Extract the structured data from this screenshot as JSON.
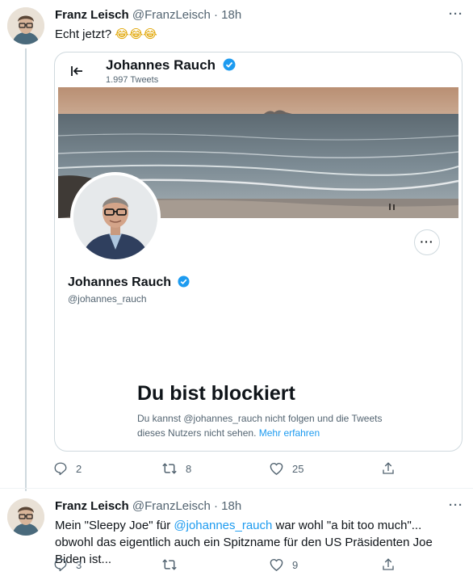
{
  "tweet1": {
    "author_name": "Franz Leisch",
    "author_handle": "@FranzLeisch",
    "separator": "·",
    "time": "18h",
    "text": "Echt jetzt?",
    "emojis": "😂😂😂",
    "more": "···",
    "card": {
      "header_name": "Johannes Rauch",
      "tweet_count": "1.997 Tweets",
      "profile_name": "Johannes Rauch",
      "profile_handle": "@johannes_rauch",
      "more": "···",
      "blocked_title": "Du bist blockiert",
      "blocked_text": "Du kannst @johannes_rauch nicht folgen und die Tweets dieses Nutzers nicht sehen.",
      "learn_more": "Mehr erfahren"
    },
    "actions": {
      "replies": "2",
      "retweets": "8",
      "likes": "25"
    }
  },
  "tweet2": {
    "author_name": "Franz Leisch",
    "author_handle": "@FranzLeisch",
    "separator": "·",
    "time": "18h",
    "more": "···",
    "text_before": "Mein \"Sleepy Joe\" für ",
    "mention": "@johannes_rauch",
    "text_after": " war wohl \"a bit too much\"... obwohl das eigentlich auch ein Spitzname für den US Präsidenten Joe Biden ist...",
    "actions": {
      "replies": "3",
      "retweets": "",
      "likes": "9"
    }
  },
  "colors": {
    "accent": "#1d9bf0",
    "text": "#0f1419",
    "muted": "#536471",
    "border": "#cfd9de"
  },
  "icons": [
    "avatar-franz",
    "back-arrow-icon",
    "verified-badge-icon",
    "reply-icon",
    "retweet-icon",
    "like-icon",
    "share-icon"
  ]
}
